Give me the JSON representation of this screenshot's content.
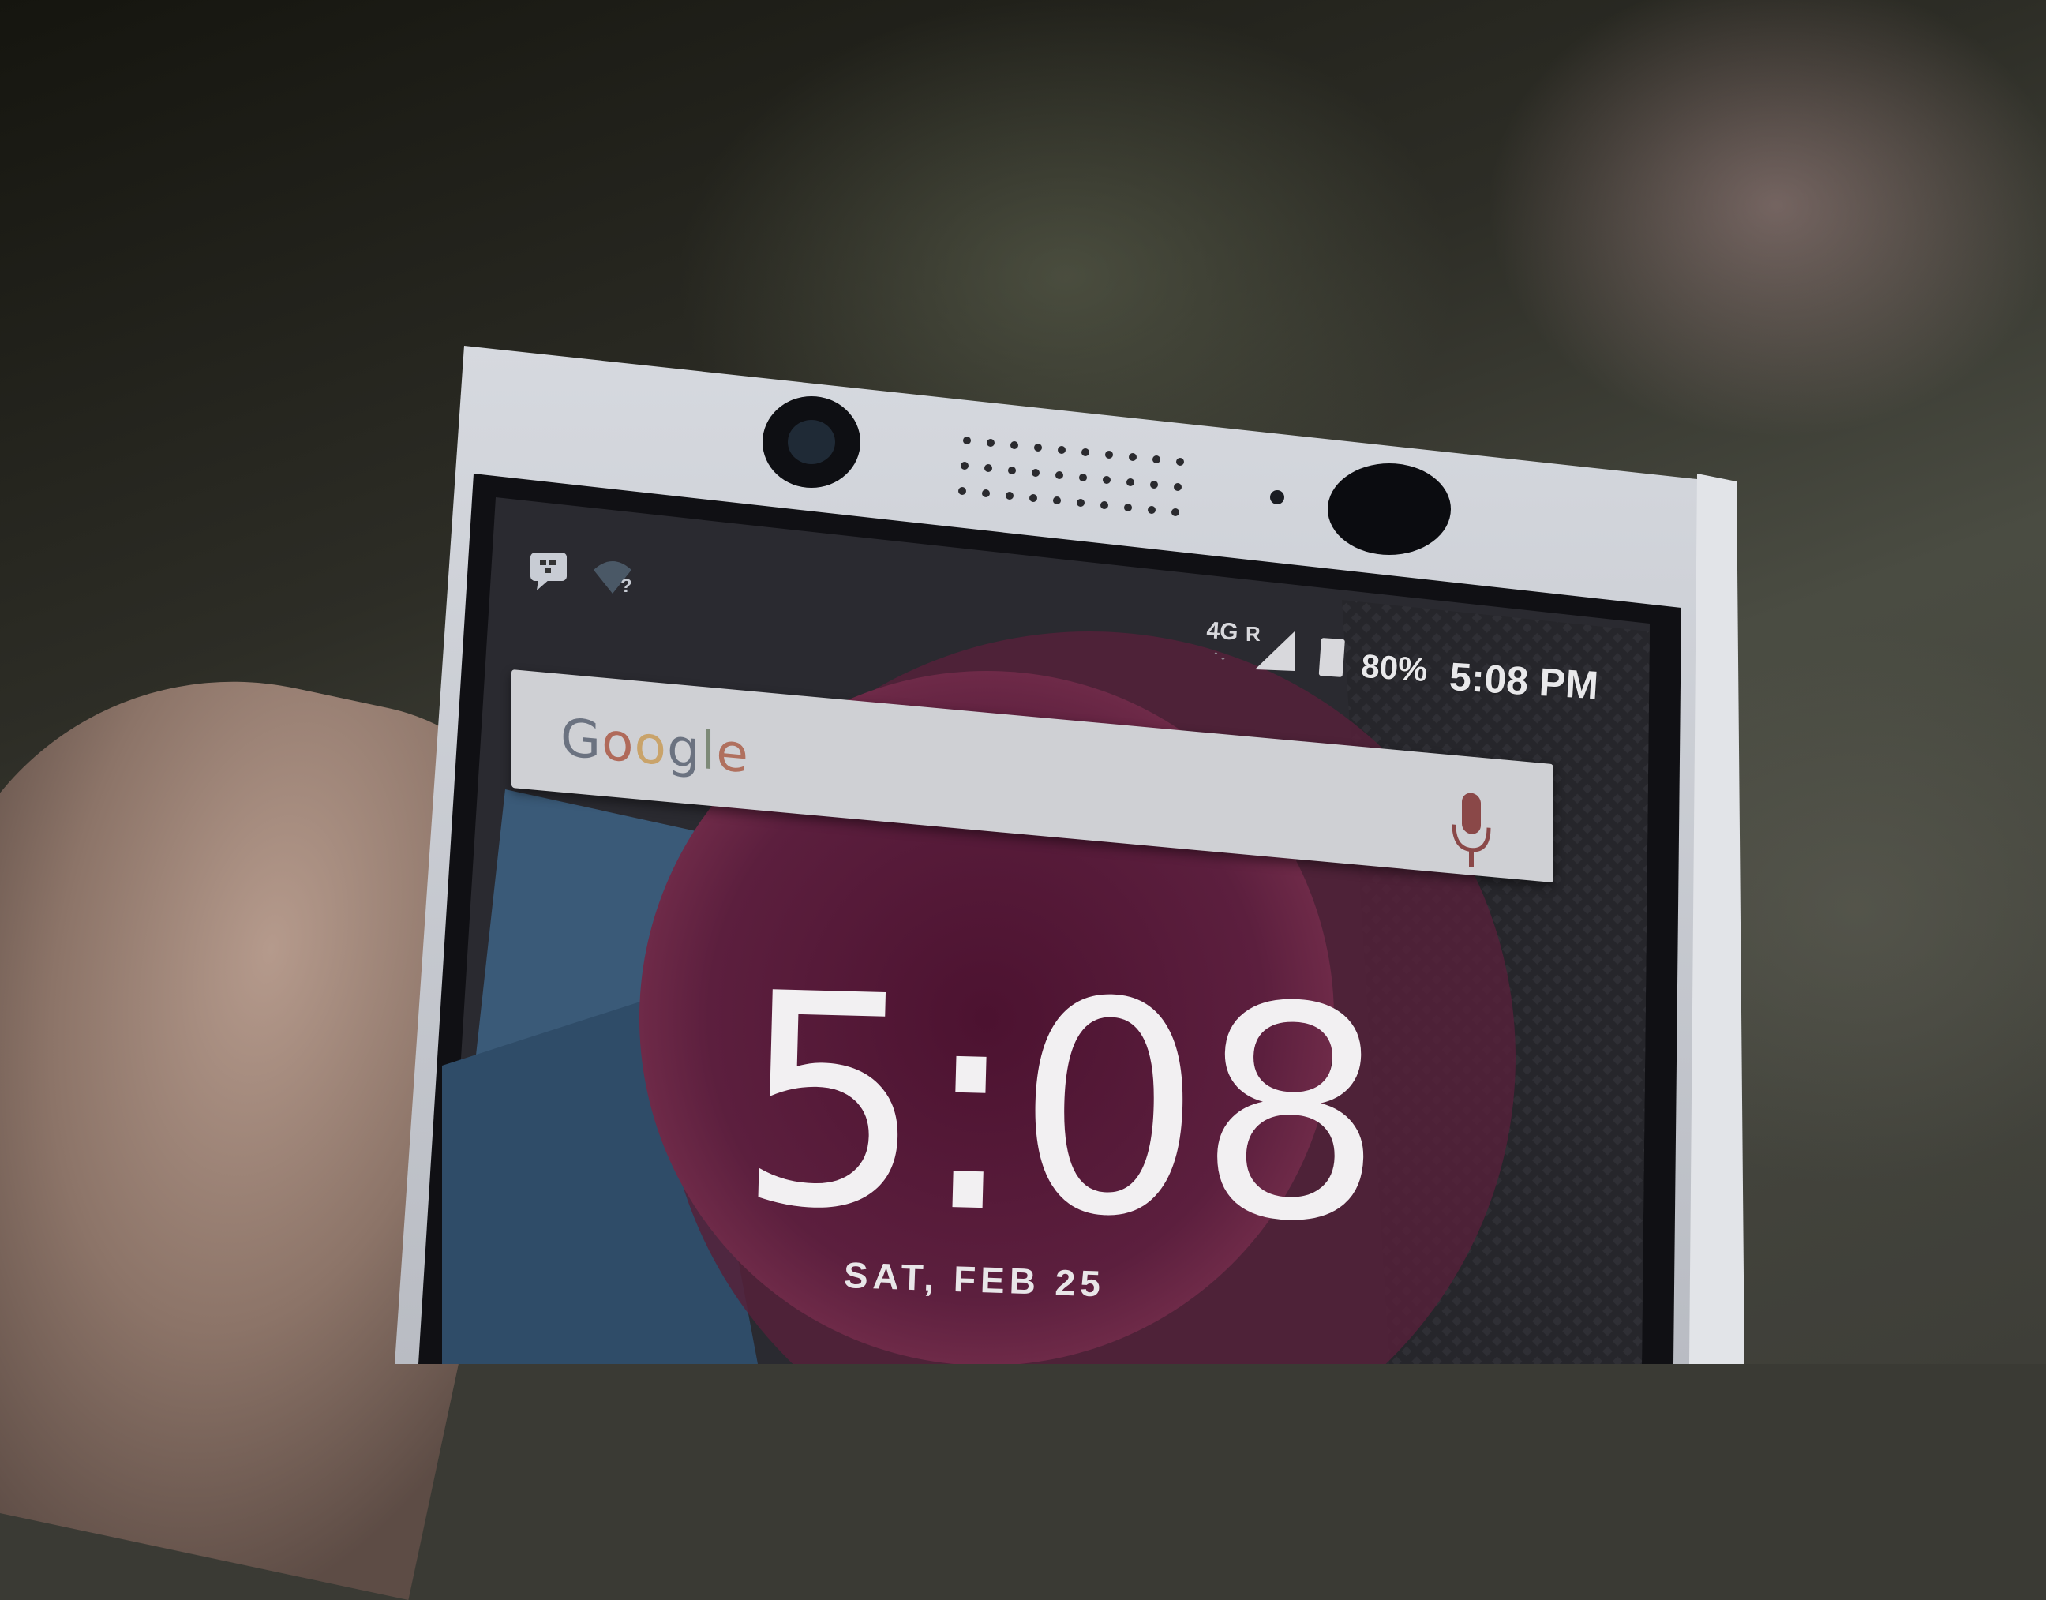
{
  "status_bar": {
    "network_label": "4G",
    "roaming_label": "R",
    "battery": "80%",
    "time": "5:08 PM",
    "notification_icons": [
      "bbm-chat-icon",
      "wifi-question-icon"
    ],
    "battery_level": 0.8
  },
  "search": {
    "logo_text": "Google",
    "logo_letters": [
      "G",
      "o",
      "o",
      "g",
      "l",
      "e"
    ],
    "logo_colors": [
      "#6b7280",
      "#b06a5a",
      "#c9a36a",
      "#6b7280",
      "#7d8a78",
      "#b0705e"
    ],
    "mic_icon": "microphone-icon"
  },
  "clock_widget": {
    "time": "5:08",
    "date": "SAT, FEB 25"
  },
  "colors": {
    "phone_frame": "#c9ccd3",
    "wallpaper_circle": "#5c1e3c",
    "wallpaper_blue": "#3a5a78"
  }
}
